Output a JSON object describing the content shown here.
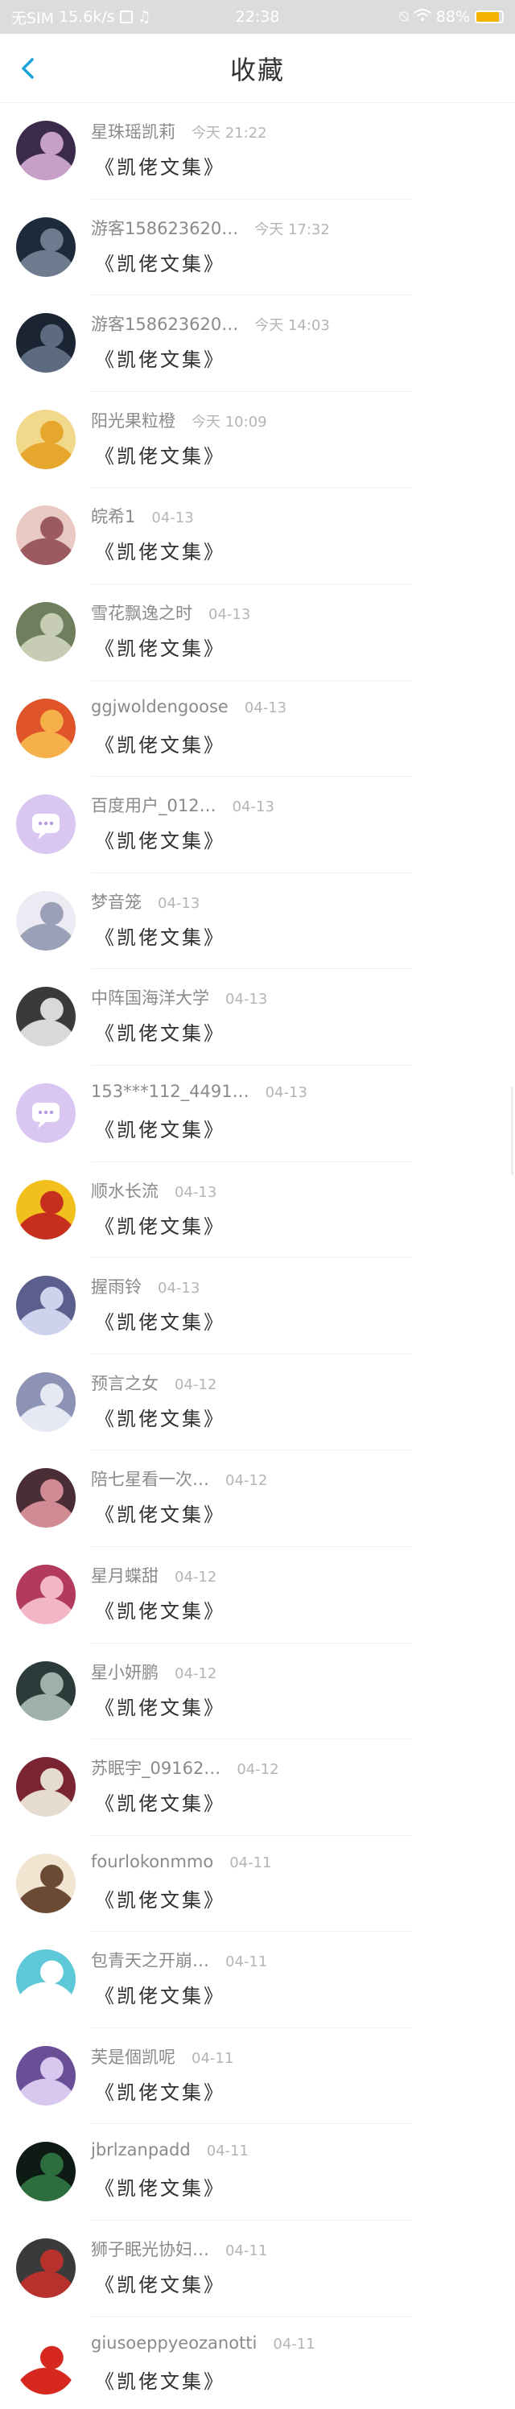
{
  "status_bar": {
    "carrier": "无SIM",
    "speed": "15.6k/s",
    "time": "22:38",
    "battery": "88%",
    "battery_level": 0.88
  },
  "header": {
    "title": "收藏"
  },
  "work_title": "《凯佬文集》",
  "items": [
    {
      "name": "星珠瑶凯莉",
      "time": "今天 21:22",
      "avatar_color": "#3b2a4a",
      "avatar_accent": "#c7a0c8",
      "icon": "anime-girl-avatar"
    },
    {
      "name": "游客158623620…",
      "time": "今天 17:32",
      "avatar_color": "#1d2a3a",
      "avatar_accent": "#6e7b8e",
      "icon": "dark-figure-avatar"
    },
    {
      "name": "游客158623620…",
      "time": "今天 14:03",
      "avatar_color": "#1b2433",
      "avatar_accent": "#5d6b80",
      "icon": "dark-figure-avatar"
    },
    {
      "name": "阳光果粒橙",
      "time": "今天 10:09",
      "avatar_color": "#f2d88a",
      "avatar_accent": "#e7a72c",
      "icon": "flower-avatar"
    },
    {
      "name": "皖希1",
      "time": "04-13",
      "avatar_color": "#e9c9c1",
      "avatar_accent": "#9a5a60",
      "icon": "anime-girl-avatar"
    },
    {
      "name": "雪花飘逸之时",
      "time": "04-13",
      "avatar_color": "#6f7e5c",
      "avatar_accent": "#c6cdb4",
      "icon": "landscape-avatar"
    },
    {
      "name": "ggjwoldengoose",
      "time": "04-13",
      "avatar_color": "#e0542a",
      "avatar_accent": "#f6b04a",
      "icon": "fruit-avatar"
    },
    {
      "name": "百度用户_012…",
      "time": "04-13",
      "avatar_color": "#d9c6f1",
      "avatar_accent": "#b79ae4",
      "icon": "default-chat-avatar"
    },
    {
      "name": "梦音笼",
      "time": "04-13",
      "avatar_color": "#eceaf2",
      "avatar_accent": "#9aa0b8",
      "icon": "white-hair-avatar"
    },
    {
      "name": "中阵国海洋大学",
      "time": "04-13",
      "avatar_color": "#3a3a3a",
      "avatar_accent": "#d9d9d9",
      "icon": "monochrome-avatar"
    },
    {
      "name": "153***112_4491…",
      "time": "04-13",
      "avatar_color": "#d9c6f1",
      "avatar_accent": "#b79ae4",
      "icon": "default-chat-avatar"
    },
    {
      "name": "顺水长流",
      "time": "04-13",
      "avatar_color": "#f2c01c",
      "avatar_accent": "#c62f1e",
      "icon": "sunset-avatar"
    },
    {
      "name": "握雨铃",
      "time": "04-13",
      "avatar_color": "#5a5f8d",
      "avatar_accent": "#cfd2ec",
      "icon": "anime-girl-avatar"
    },
    {
      "name": "预言之女",
      "time": "04-12",
      "avatar_color": "#8d93b5",
      "avatar_accent": "#e6e8f3",
      "icon": "anime-girl-avatar"
    },
    {
      "name": "陪七星看一次…",
      "time": "04-12",
      "avatar_color": "#4a2d35",
      "avatar_accent": "#d08b95",
      "icon": "anime-girl-avatar"
    },
    {
      "name": "星月蝶甜",
      "time": "04-12",
      "avatar_color": "#b23a5c",
      "avatar_accent": "#f2b6c7",
      "icon": "anime-girl-avatar"
    },
    {
      "name": "星小妍鹏",
      "time": "04-12",
      "avatar_color": "#2d3a3a",
      "avatar_accent": "#9fb2aa",
      "icon": "portrait-avatar"
    },
    {
      "name": "苏眠宇_09162…",
      "time": "04-12",
      "avatar_color": "#7a2433",
      "avatar_accent": "#e5dccf",
      "icon": "portrait-avatar"
    },
    {
      "name": "fourlokonmmo",
      "time": "04-11",
      "avatar_color": "#f1e4d0",
      "avatar_accent": "#6b4a33",
      "icon": "cartoon-avatar"
    },
    {
      "name": "包青天之开崩…",
      "time": "04-11",
      "avatar_color": "#5cc8d8",
      "avatar_accent": "#ffffff",
      "icon": "cartoon-avatar"
    },
    {
      "name": "芙是個凯呢",
      "time": "04-11",
      "avatar_color": "#6a4f96",
      "avatar_accent": "#d8c8ef",
      "icon": "anime-girl-avatar"
    },
    {
      "name": "jbrlzanpadd",
      "time": "04-11",
      "avatar_color": "#0e1a14",
      "avatar_accent": "#2d6e3f",
      "icon": "night-avatar"
    },
    {
      "name": "狮子眠光协妇…",
      "time": "04-11",
      "avatar_color": "#3a3a3a",
      "avatar_accent": "#b7322d",
      "icon": "car-avatar"
    },
    {
      "name": "giusoeppyeozanotti",
      "time": "04-11",
      "avatar_color": "#ffffff",
      "avatar_accent": "#d6281e",
      "icon": "cartoon-avatar"
    }
  ]
}
